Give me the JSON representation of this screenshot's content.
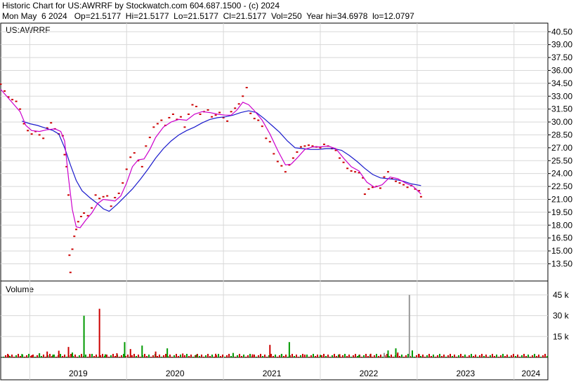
{
  "header": {
    "line1": "Historic Chart for US:AWRRF by Stockwatch.com 604.687.1500 - (c) 2024",
    "line2": "Mon May  6 2024   Op=21.5177  Hi=21.5177  Lo=21.5177  Cl=21.5177  Vol=250  Year hi=34.6978  lo=12.0797"
  },
  "chart_data": [
    {
      "type": "line",
      "title": "US:AWRRF",
      "ylim": [
        11.5,
        41.5
      ],
      "yticks": [
        "40.50",
        "39.00",
        "37.50",
        "36.00",
        "34.50",
        "33.00",
        "31.50",
        "30.00",
        "28.50",
        "27.00",
        "25.50",
        "24.00",
        "22.50",
        "21.00",
        "19.50",
        "18.00",
        "16.50",
        "15.00",
        "13.50"
      ],
      "xlabels": [
        "2019",
        "2020",
        "2021",
        "2022",
        "2023",
        "2024"
      ],
      "xlim": [
        2018.7,
        2024.35
      ],
      "price_points": [
        [
          2018.7,
          34.4
        ],
        [
          2018.74,
          33.6
        ],
        [
          2018.78,
          32.9
        ],
        [
          2018.82,
          32.6
        ],
        [
          2018.86,
          32.4
        ],
        [
          2018.9,
          31.5
        ],
        [
          2018.94,
          29.8
        ],
        [
          2018.98,
          29.0
        ],
        [
          2019.02,
          28.6
        ],
        [
          2019.06,
          28.9
        ],
        [
          2019.1,
          28.5
        ],
        [
          2019.14,
          28.1
        ],
        [
          2019.18,
          29.3
        ],
        [
          2019.22,
          29.9
        ],
        [
          2019.26,
          29.2
        ],
        [
          2019.3,
          28.6
        ],
        [
          2019.34,
          28.4
        ],
        [
          2019.36,
          26.2
        ],
        [
          2019.38,
          24.8
        ],
        [
          2019.4,
          21.5
        ],
        [
          2019.41,
          14.5
        ],
        [
          2019.42,
          12.5
        ],
        [
          2019.44,
          15.2
        ],
        [
          2019.46,
          16.7
        ],
        [
          2019.48,
          17.5
        ],
        [
          2019.5,
          18.4
        ],
        [
          2019.53,
          19.0
        ],
        [
          2019.56,
          19.4
        ],
        [
          2019.6,
          19.1
        ],
        [
          2019.64,
          20.0
        ],
        [
          2019.68,
          21.5
        ],
        [
          2019.72,
          21.1
        ],
        [
          2019.76,
          21.3
        ],
        [
          2019.8,
          21.4
        ],
        [
          2019.84,
          20.2
        ],
        [
          2019.88,
          21.2
        ],
        [
          2019.92,
          21.7
        ],
        [
          2019.96,
          22.9
        ],
        [
          2020.0,
          24.5
        ],
        [
          2020.04,
          25.9
        ],
        [
          2020.08,
          26.4
        ],
        [
          2020.12,
          25.5
        ],
        [
          2020.16,
          24.8
        ],
        [
          2020.2,
          27.2
        ],
        [
          2020.24,
          28.2
        ],
        [
          2020.28,
          29.4
        ],
        [
          2020.32,
          29.8
        ],
        [
          2020.36,
          30.2
        ],
        [
          2020.4,
          29.6
        ],
        [
          2020.44,
          30.5
        ],
        [
          2020.48,
          30.9
        ],
        [
          2020.52,
          30.3
        ],
        [
          2020.56,
          30.6
        ],
        [
          2020.6,
          29.4
        ],
        [
          2020.64,
          30.9
        ],
        [
          2020.68,
          32.0
        ],
        [
          2020.72,
          31.8
        ],
        [
          2020.76,
          30.9
        ],
        [
          2020.8,
          31.2
        ],
        [
          2020.84,
          31.4
        ],
        [
          2020.88,
          30.6
        ],
        [
          2020.92,
          30.8
        ],
        [
          2020.96,
          31.1
        ],
        [
          2021.0,
          30.5
        ],
        [
          2021.04,
          30.1
        ],
        [
          2021.08,
          31.2
        ],
        [
          2021.12,
          31.6
        ],
        [
          2021.16,
          32.1
        ],
        [
          2021.2,
          33.0
        ],
        [
          2021.24,
          34.0
        ],
        [
          2021.28,
          31.0
        ],
        [
          2021.32,
          30.4
        ],
        [
          2021.36,
          30.2
        ],
        [
          2021.4,
          29.5
        ],
        [
          2021.44,
          28.1
        ],
        [
          2021.48,
          27.7
        ],
        [
          2021.52,
          26.3
        ],
        [
          2021.56,
          25.4
        ],
        [
          2021.6,
          24.9
        ],
        [
          2021.64,
          24.2
        ],
        [
          2021.68,
          25.0
        ],
        [
          2021.72,
          25.8
        ],
        [
          2021.76,
          26.5
        ],
        [
          2021.8,
          27.1
        ],
        [
          2021.84,
          27.2
        ],
        [
          2021.88,
          27.3
        ],
        [
          2021.92,
          27.2
        ],
        [
          2021.96,
          27.1
        ],
        [
          2022.0,
          27.0
        ],
        [
          2022.04,
          27.4
        ],
        [
          2022.08,
          27.2
        ],
        [
          2022.12,
          26.9
        ],
        [
          2022.16,
          26.7
        ],
        [
          2022.2,
          25.8
        ],
        [
          2022.24,
          25.3
        ],
        [
          2022.28,
          24.6
        ],
        [
          2022.32,
          24.3
        ],
        [
          2022.36,
          24.2
        ],
        [
          2022.4,
          24.1
        ],
        [
          2022.44,
          23.5
        ],
        [
          2022.46,
          21.6
        ],
        [
          2022.5,
          22.2
        ],
        [
          2022.54,
          22.4
        ],
        [
          2022.58,
          22.5
        ],
        [
          2022.62,
          22.3
        ],
        [
          2022.66,
          23.6
        ],
        [
          2022.7,
          24.2
        ],
        [
          2022.74,
          23.4
        ],
        [
          2022.78,
          23.1
        ],
        [
          2022.82,
          22.9
        ],
        [
          2022.86,
          22.7
        ],
        [
          2022.9,
          22.4
        ],
        [
          2022.94,
          22.6
        ],
        [
          2022.98,
          22.2
        ],
        [
          2023.02,
          22.0
        ],
        [
          2023.04,
          21.3
        ]
      ],
      "ma_fast": [
        [
          2018.7,
          33.8
        ],
        [
          2018.8,
          32.5
        ],
        [
          2018.9,
          31.2
        ],
        [
          2018.96,
          29.6
        ],
        [
          2019.02,
          29.0
        ],
        [
          2019.1,
          28.9
        ],
        [
          2019.18,
          29.1
        ],
        [
          2019.26,
          29.2
        ],
        [
          2019.32,
          28.9
        ],
        [
          2019.36,
          27.8
        ],
        [
          2019.4,
          23.5
        ],
        [
          2019.44,
          19.8
        ],
        [
          2019.48,
          17.8
        ],
        [
          2019.52,
          17.7
        ],
        [
          2019.58,
          18.6
        ],
        [
          2019.64,
          19.4
        ],
        [
          2019.7,
          20.5
        ],
        [
          2019.76,
          21.0
        ],
        [
          2019.82,
          20.9
        ],
        [
          2019.88,
          20.8
        ],
        [
          2019.94,
          21.4
        ],
        [
          2020.0,
          22.9
        ],
        [
          2020.06,
          24.8
        ],
        [
          2020.12,
          25.6
        ],
        [
          2020.18,
          25.7
        ],
        [
          2020.24,
          26.8
        ],
        [
          2020.3,
          28.2
        ],
        [
          2020.38,
          29.4
        ],
        [
          2020.46,
          30.0
        ],
        [
          2020.54,
          30.3
        ],
        [
          2020.62,
          30.2
        ],
        [
          2020.7,
          30.9
        ],
        [
          2020.78,
          31.2
        ],
        [
          2020.86,
          31.1
        ],
        [
          2020.94,
          30.9
        ],
        [
          2021.02,
          30.8
        ],
        [
          2021.08,
          30.8
        ],
        [
          2021.14,
          31.4
        ],
        [
          2021.2,
          32.3
        ],
        [
          2021.26,
          32.0
        ],
        [
          2021.32,
          31.3
        ],
        [
          2021.4,
          30.2
        ],
        [
          2021.48,
          28.6
        ],
        [
          2021.56,
          26.7
        ],
        [
          2021.64,
          25.0
        ],
        [
          2021.7,
          25.1
        ],
        [
          2021.76,
          25.8
        ],
        [
          2021.84,
          26.8
        ],
        [
          2021.92,
          27.1
        ],
        [
          2022.0,
          27.1
        ],
        [
          2022.08,
          27.2
        ],
        [
          2022.16,
          26.9
        ],
        [
          2022.24,
          25.8
        ],
        [
          2022.32,
          24.8
        ],
        [
          2022.4,
          24.3
        ],
        [
          2022.48,
          23.0
        ],
        [
          2022.56,
          22.4
        ],
        [
          2022.64,
          22.7
        ],
        [
          2022.72,
          23.6
        ],
        [
          2022.8,
          23.4
        ],
        [
          2022.88,
          22.9
        ],
        [
          2022.96,
          22.5
        ],
        [
          2023.04,
          21.6
        ]
      ],
      "ma_slow": [
        [
          2018.92,
          30.1
        ],
        [
          2019.0,
          29.8
        ],
        [
          2019.08,
          29.6
        ],
        [
          2019.16,
          29.3
        ],
        [
          2019.24,
          29.0
        ],
        [
          2019.3,
          28.6
        ],
        [
          2019.36,
          27.0
        ],
        [
          2019.42,
          25.0
        ],
        [
          2019.48,
          23.2
        ],
        [
          2019.54,
          22.0
        ],
        [
          2019.62,
          21.2
        ],
        [
          2019.7,
          20.5
        ],
        [
          2019.76,
          19.9
        ],
        [
          2019.82,
          19.6
        ],
        [
          2019.9,
          20.4
        ],
        [
          2019.98,
          21.3
        ],
        [
          2020.06,
          22.2
        ],
        [
          2020.14,
          23.3
        ],
        [
          2020.22,
          24.5
        ],
        [
          2020.3,
          25.8
        ],
        [
          2020.38,
          26.9
        ],
        [
          2020.46,
          27.8
        ],
        [
          2020.54,
          28.5
        ],
        [
          2020.62,
          29.0
        ],
        [
          2020.7,
          29.4
        ],
        [
          2020.78,
          29.9
        ],
        [
          2020.86,
          30.3
        ],
        [
          2020.94,
          30.5
        ],
        [
          2021.02,
          30.6
        ],
        [
          2021.1,
          30.8
        ],
        [
          2021.18,
          31.1
        ],
        [
          2021.26,
          31.3
        ],
        [
          2021.34,
          31.1
        ],
        [
          2021.42,
          30.4
        ],
        [
          2021.5,
          29.6
        ],
        [
          2021.58,
          28.8
        ],
        [
          2021.66,
          27.8
        ],
        [
          2021.74,
          27.0
        ],
        [
          2021.82,
          26.9
        ],
        [
          2021.9,
          26.8
        ],
        [
          2021.98,
          26.8
        ],
        [
          2022.06,
          26.9
        ],
        [
          2022.14,
          26.9
        ],
        [
          2022.22,
          26.7
        ],
        [
          2022.3,
          26.1
        ],
        [
          2022.38,
          25.4
        ],
        [
          2022.46,
          24.6
        ],
        [
          2022.54,
          23.9
        ],
        [
          2022.62,
          23.5
        ],
        [
          2022.7,
          23.4
        ],
        [
          2022.78,
          23.3
        ],
        [
          2022.86,
          23.1
        ],
        [
          2022.94,
          22.8
        ],
        [
          2023.04,
          22.6
        ]
      ]
    },
    {
      "type": "bar",
      "title": "Volume",
      "ylim": [
        0,
        55000
      ],
      "yticks": [
        "45 k",
        "30 k",
        "15 k"
      ],
      "spikes": [
        [
          2018.78,
          1800,
          "#cc0000"
        ],
        [
          2018.92,
          2400,
          "#009900"
        ],
        [
          2019.02,
          1500,
          "#cc0000"
        ],
        [
          2019.1,
          3000,
          "#009900"
        ],
        [
          2019.18,
          4200,
          "#cc0000"
        ],
        [
          2019.24,
          2000,
          "#009900"
        ],
        [
          2019.3,
          4800,
          "#cc0000"
        ],
        [
          2019.4,
          7500,
          "#cc0000"
        ],
        [
          2019.44,
          3500,
          "#009900"
        ],
        [
          2019.56,
          30000,
          "#009900"
        ],
        [
          2019.62,
          2500,
          "#cc0000"
        ],
        [
          2019.72,
          35000,
          "#cc0000"
        ],
        [
          2019.78,
          2200,
          "#009900"
        ],
        [
          2019.9,
          3000,
          "#cc0000"
        ],
        [
          2019.98,
          11000,
          "#009900"
        ],
        [
          2020.04,
          6000,
          "#cc0000"
        ],
        [
          2020.16,
          8500,
          "#009900"
        ],
        [
          2020.3,
          4200,
          "#cc0000"
        ],
        [
          2020.42,
          6500,
          "#009900"
        ],
        [
          2020.58,
          2800,
          "#cc0000"
        ],
        [
          2020.72,
          2000,
          "#009900"
        ],
        [
          2020.92,
          2600,
          "#cc0000"
        ],
        [
          2021.1,
          3200,
          "#009900"
        ],
        [
          2021.3,
          2200,
          "#cc0000"
        ],
        [
          2021.48,
          9000,
          "#cc0000"
        ],
        [
          2021.6,
          2500,
          "#009900"
        ],
        [
          2021.68,
          11000,
          "#009900"
        ],
        [
          2021.84,
          2000,
          "#cc0000"
        ],
        [
          2022.0,
          1800,
          "#009900"
        ],
        [
          2022.2,
          2300,
          "#cc0000"
        ],
        [
          2022.4,
          1800,
          "#009900"
        ],
        [
          2022.52,
          2600,
          "#cc0000"
        ],
        [
          2022.66,
          3200,
          "#999999"
        ],
        [
          2022.7,
          5000,
          "#009900"
        ],
        [
          2022.78,
          6500,
          "#009900"
        ],
        [
          2022.8,
          3500,
          "#cc0000"
        ],
        [
          2022.92,
          45000,
          "#999999"
        ],
        [
          2022.95,
          5000,
          "#009900"
        ],
        [
          2023.02,
          2400,
          "#cc0000"
        ]
      ]
    }
  ]
}
